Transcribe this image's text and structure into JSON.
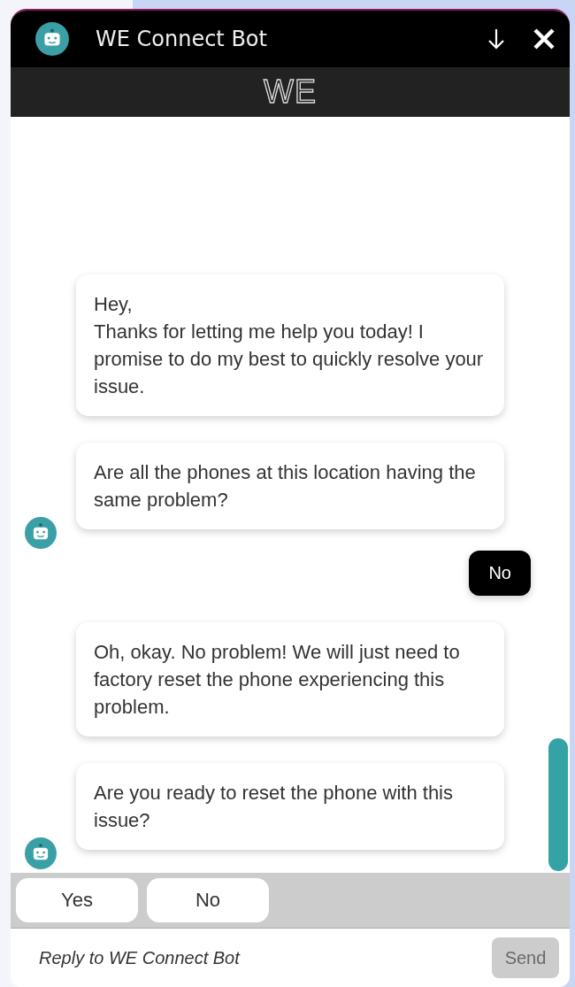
{
  "header": {
    "title": "WE Connect Bot",
    "logo": "WE"
  },
  "messages": [
    {
      "kind": "bot",
      "text": "Hey,\nThanks for letting me help you today! I promise to do my best to quickly resolve your issue.",
      "avatar": false
    },
    {
      "kind": "bot",
      "text": "Are all the phones at this location having the same problem?",
      "avatar": true
    },
    {
      "kind": "user",
      "text": "No"
    },
    {
      "kind": "bot",
      "text": "Oh, okay. No problem! We will just need to factory reset the phone experiencing this problem.",
      "avatar": false
    },
    {
      "kind": "bot",
      "text": "Are you ready to reset the phone with this issue?",
      "avatar": true
    }
  ],
  "quick_replies": [
    "Yes",
    "No"
  ],
  "composer": {
    "placeholder": "Reply to WE Connect Bot",
    "send": "Send",
    "send_disabled": true
  }
}
